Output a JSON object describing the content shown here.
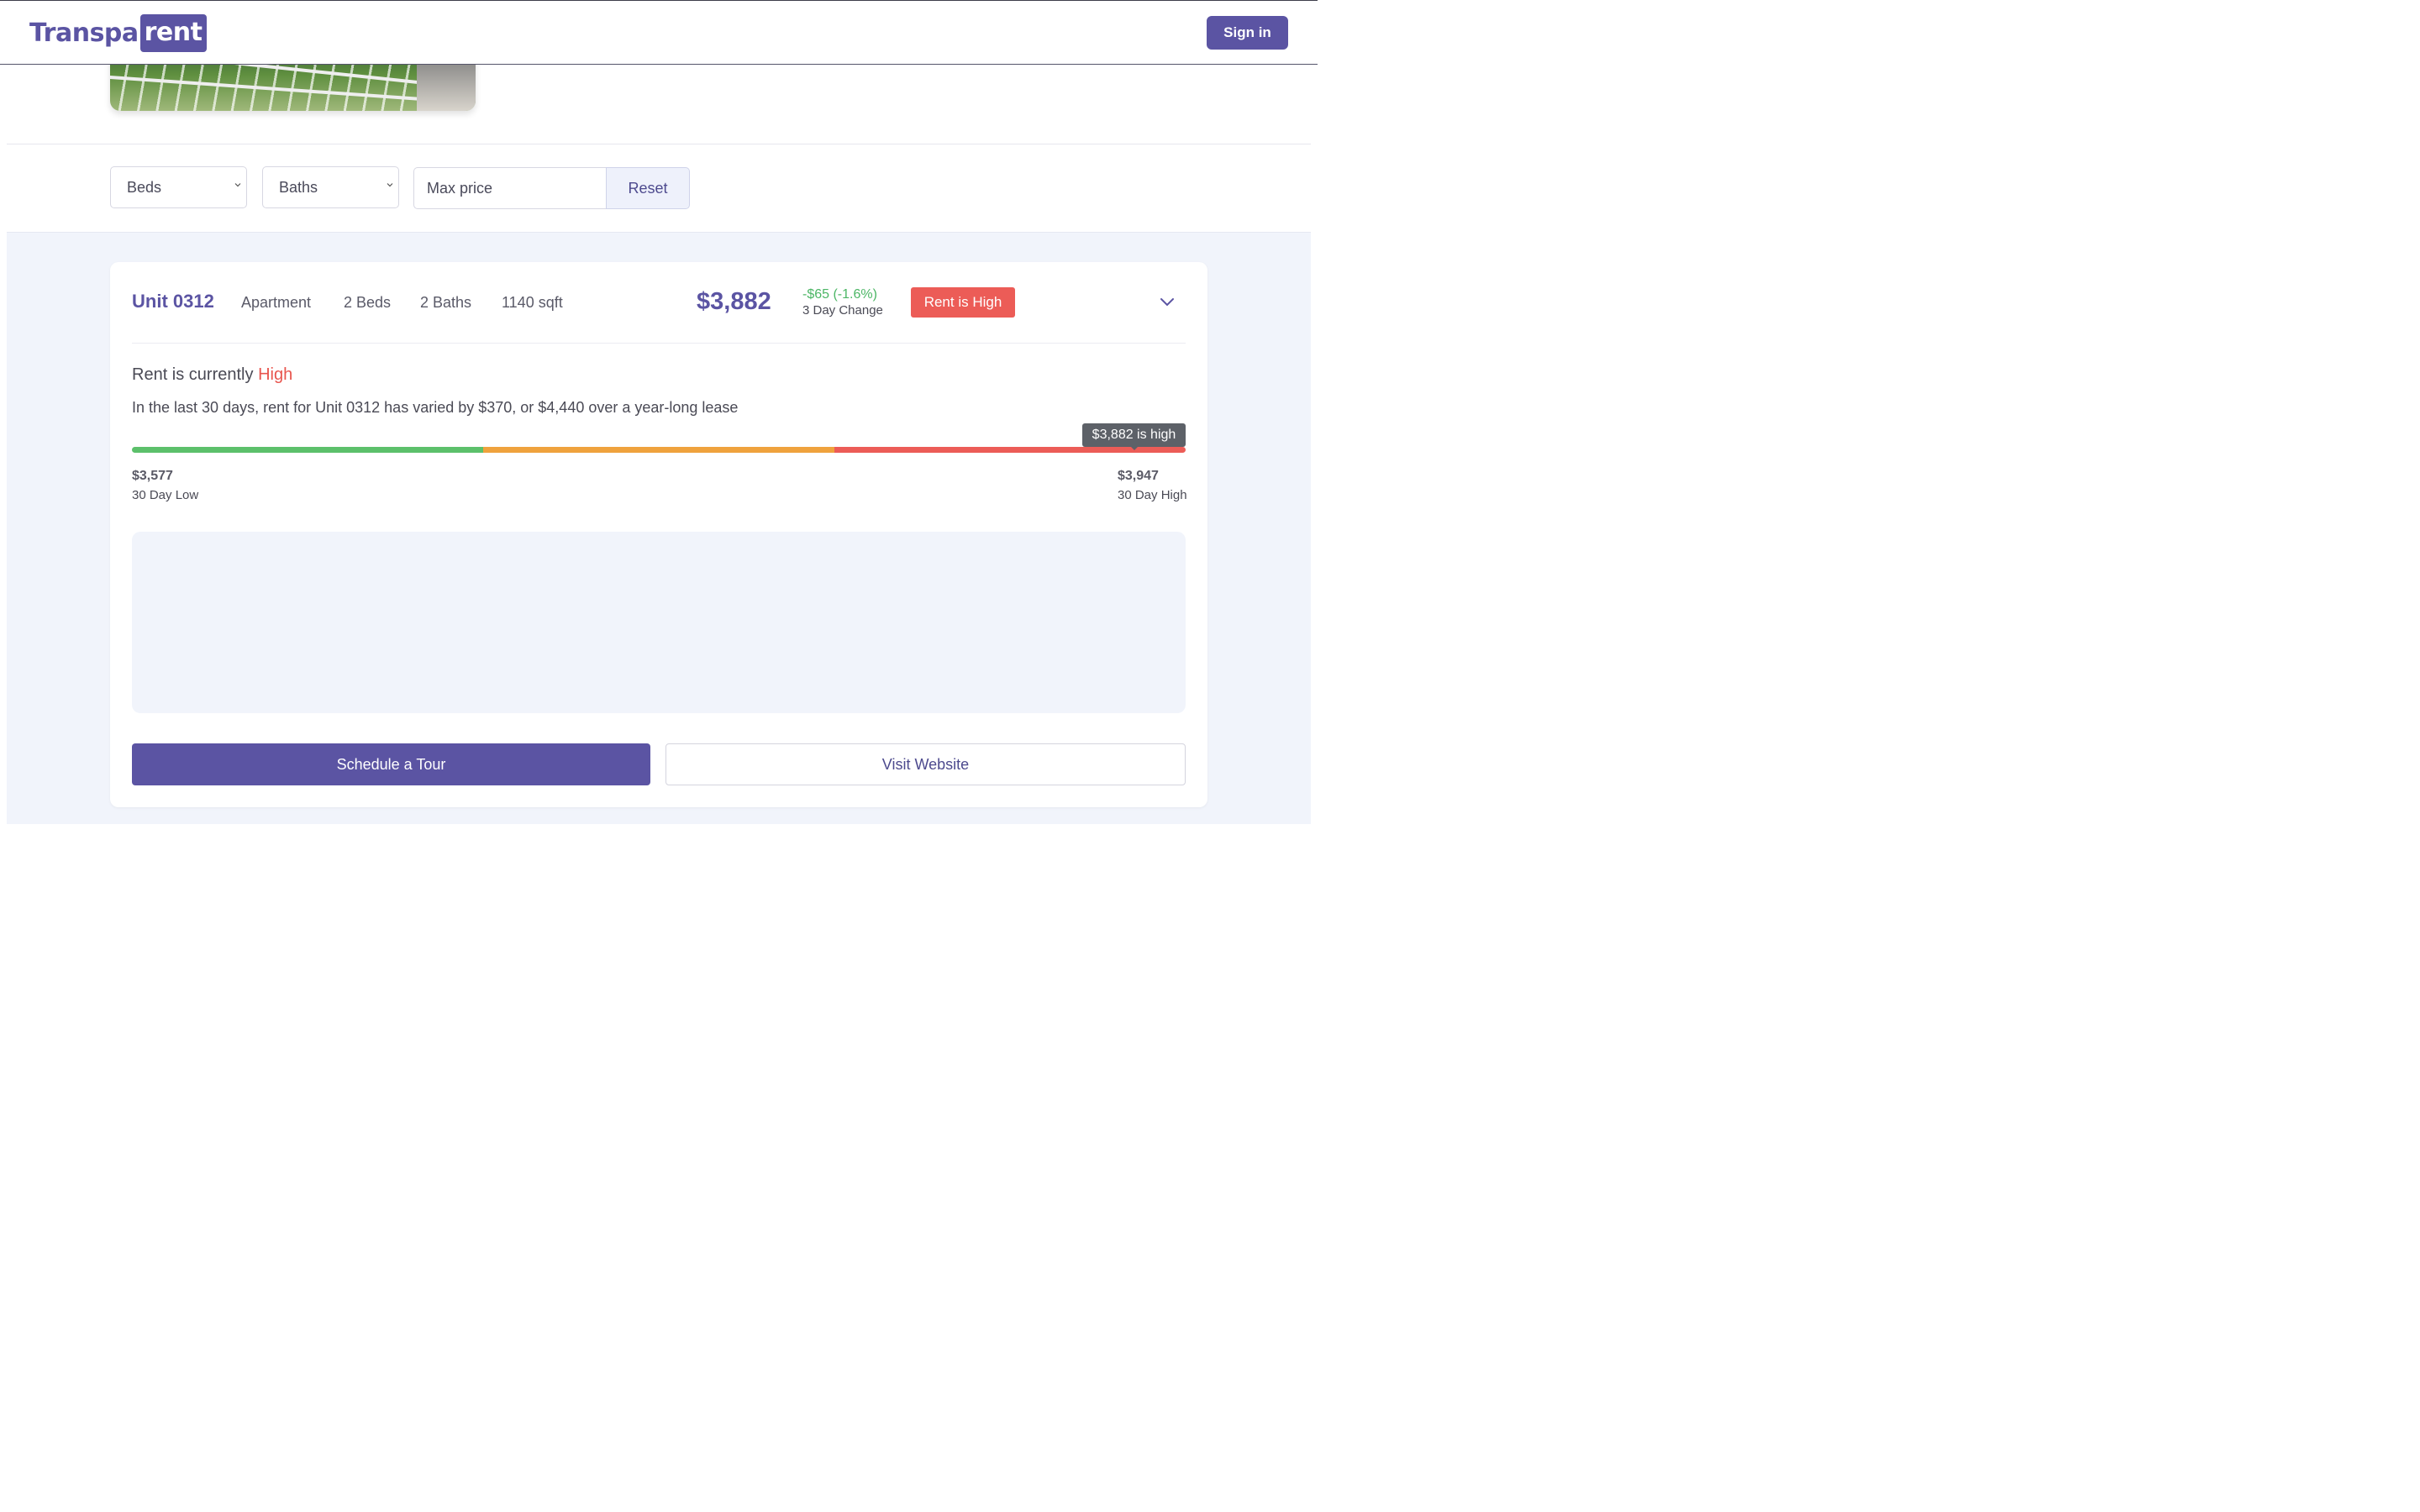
{
  "header": {
    "logo_left": "Transpa",
    "logo_right": "rent",
    "signin_label": "Sign in"
  },
  "filters": {
    "beds_label": "Beds",
    "baths_label": "Baths",
    "maxprice_placeholder": "Max price",
    "reset_label": "Reset"
  },
  "unit": {
    "name": "Unit 0312",
    "type": "Apartment",
    "beds": "2 Beds",
    "baths": "2 Baths",
    "sqft": "1140 sqft",
    "price": "$3,882",
    "change_value": "-$65 (-1.6%)",
    "change_label": "3 Day Change",
    "badge": "Rent is High",
    "status_prefix": "Rent is currently ",
    "status_value": "High",
    "description": "In the last 30 days, rent for Unit 0312 has varied by $370, or $4,440 over a year-long lease",
    "tooltip": "$3,882 is high",
    "low_value": "$3,577",
    "low_label": "30 Day Low",
    "high_value": "$3,947",
    "high_label": "30 Day High"
  },
  "actions": {
    "tour_label": "Schedule a Tour",
    "website_label": "Visit Website"
  },
  "colors": {
    "brand": "#5b54a3",
    "high": "#ec5c57",
    "mid": "#efa23d",
    "low": "#5cc06b"
  }
}
